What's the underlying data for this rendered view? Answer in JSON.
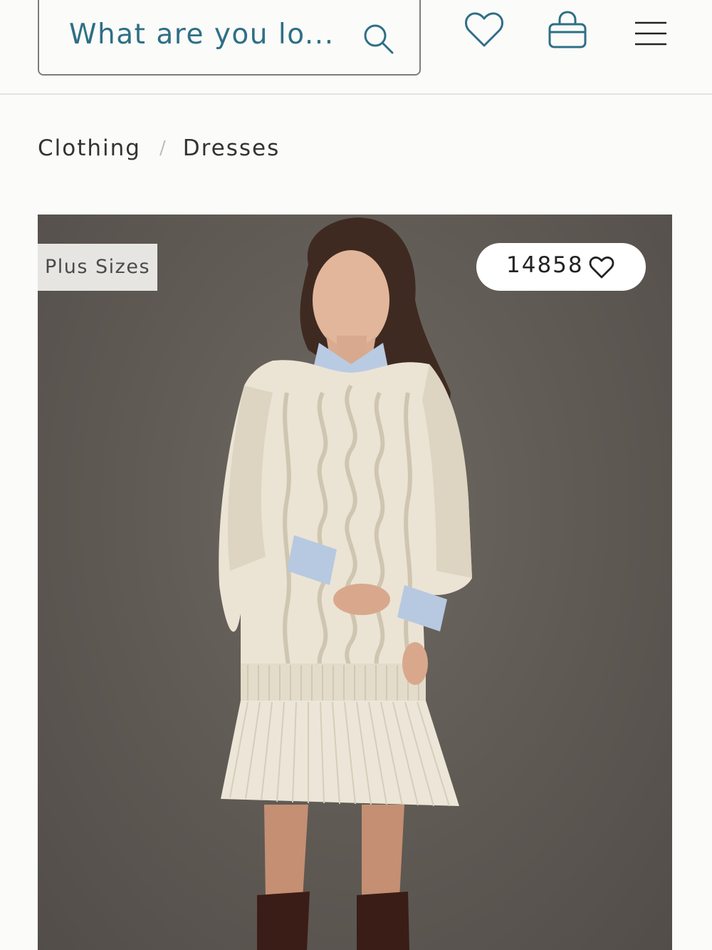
{
  "header": {
    "search": {
      "text": "What are you lo..."
    },
    "icons": {
      "search": "search-icon",
      "wishlist": "heart-icon",
      "bag": "shopping-bag-icon",
      "menu": "hamburger-menu-icon"
    }
  },
  "breadcrumb": {
    "items": [
      "Clothing",
      "Dresses"
    ],
    "separator": "/"
  },
  "product": {
    "badge": "Plus Sizes",
    "like_count": "14858"
  },
  "colors": {
    "accent": "#2e6f86",
    "background": "#fbfbf9",
    "photo_backdrop": "#5f5954"
  }
}
